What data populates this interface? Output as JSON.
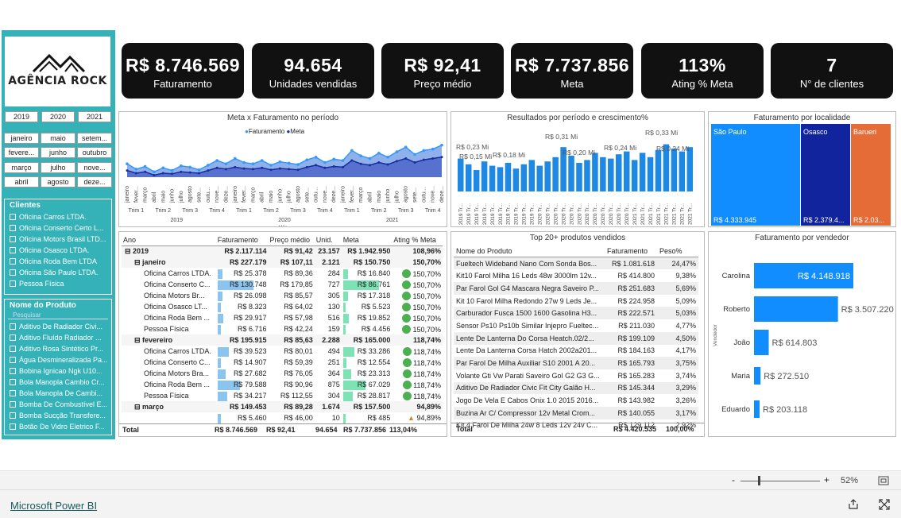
{
  "logo": {
    "text": "AGÊNCIA ROCK"
  },
  "years": [
    "2019",
    "2020",
    "2021"
  ],
  "months": [
    "janeiro",
    "maio",
    "setem...",
    "fevere...",
    "junho",
    "outubro",
    "março",
    "julho",
    "nove...",
    "abril",
    "agosto",
    "deze..."
  ],
  "clients": {
    "title": "Clientes",
    "items": [
      "Oficina Carros LTDA.",
      "Oficina Conserto Certo L...",
      "Oficina Motors Brasil LTD...",
      "Oficina Osasco LTDA.",
      "Oficina Roda Bem LTDA",
      "Oficina São Paulo LTDA.",
      "Pessoa Física"
    ]
  },
  "products_filter": {
    "title": "Nome do Produto",
    "placeholder": "Pesquisar",
    "items": [
      "Aditivo De Radiador Civi...",
      "Aditivo Fluído Radiador ...",
      "Aditivo Rosa Sintético Pr...",
      "Água Desmineralizada Pa...",
      "Bobina Ignicao Ngk U10...",
      "Bola Manopla Cambio Cr...",
      "Bola Manopla De Cambi...",
      "Bomba De Combustível E...",
      "Bomba Sucção Transfere...",
      "Botão De Vidro Eletrico F..."
    ]
  },
  "kpis": [
    {
      "value": "R$ 8.746.569",
      "label": "Faturamento"
    },
    {
      "value": "94.654",
      "label": "Unidades vendidas"
    },
    {
      "value": "R$ 92,41",
      "label": "Preço médio"
    },
    {
      "value": "R$ 7.737.856",
      "label": "Meta"
    },
    {
      "value": "113%",
      "label": "Ating % Meta"
    },
    {
      "value": "7",
      "label": "N° de clientes"
    }
  ],
  "chart_data": [
    {
      "type": "area",
      "title": "Meta x Faturamento no período",
      "series": [
        {
          "name": "Faturamento"
        },
        {
          "name": "Meta"
        }
      ],
      "x_months": [
        "janeiro",
        "fever...",
        "março",
        "abril",
        "maio",
        "junho",
        "julho",
        "agosto",
        "sete...",
        "outu...",
        "nove...",
        "deze..."
      ],
      "quarters": [
        "Trim 1",
        "Trim 2",
        "Trim 3",
        "Trim 4"
      ],
      "years": [
        "2019",
        "2020",
        "2021"
      ],
      "xlabel": "Mês"
    },
    {
      "type": "bar",
      "title": "Resultados por período e crescimento%",
      "annotations": [
        "R$ 0,23 Mi",
        "R$ 0,15 Mi",
        "R$ 0,18 Mi",
        "R$ 0,31 Mi",
        "R$ 0,20 Mi",
        "R$ 0,24 Mi",
        "R$ 0,33 Mi",
        "R$ 0,24 Mi"
      ],
      "x_labels": [
        "2019 Tr...",
        "2019 Tr...",
        "2019 Tr...",
        "2019 Tr...",
        "2019 Tr...",
        "2019 Tr...",
        "2019 Tr...",
        "2019 Tr...",
        "2019 Tr...",
        "2019 Tr...",
        "2020 Tr...",
        "2020 Tr...",
        "2020 Tr...",
        "2020 Tr...",
        "2020 Tr...",
        "2020 Tr...",
        "2020 Tr...",
        "2020 Tr...",
        "2020 Tr...",
        "2020 Tr...",
        "2020 Tr...",
        "2020 Tr...",
        "2021 Tr...",
        "2021 Tr...",
        "2021 Tr...",
        "2021 Tr...",
        "2021 Tr...",
        "2021 Tr...",
        "2021 Tr...",
        "2021 Tr..."
      ],
      "values": [
        0.23,
        0.19,
        0.15,
        0.21,
        0.18,
        0.17,
        0.2,
        0.16,
        0.19,
        0.22,
        0.18,
        0.21,
        0.24,
        0.31,
        0.25,
        0.2,
        0.22,
        0.27,
        0.24,
        0.23,
        0.26,
        0.28,
        0.22,
        0.27,
        0.24,
        0.29,
        0.33,
        0.3,
        0.28,
        0.31
      ]
    },
    {
      "type": "treemap",
      "title": "Faturamento por localidade",
      "categories": [
        "São Paulo",
        "Osasco",
        "Barueri"
      ],
      "labels": [
        "R$ 4.333.945",
        "R$ 2.379.4...",
        "R$ 2.03..."
      ],
      "values": [
        4333945,
        2379400,
        2033224
      ]
    },
    {
      "type": "bar",
      "title": "Faturamento por vendedor",
      "ylabel": "Vendedor",
      "categories": [
        "Carolina",
        "Roberto",
        "João",
        "Maria",
        "Eduardo"
      ],
      "values": [
        4148918,
        3507220,
        614803,
        272510,
        203118
      ],
      "labels": [
        "R$ 4.148.918",
        "R$ 3.507.220",
        "R$ 614.803",
        "R$ 272.510",
        "R$ 203.118"
      ]
    }
  ],
  "matrix": {
    "headers": [
      "Ano",
      "Faturamento",
      "Preço médio",
      "Unid.",
      "Meta",
      "Ating % Meta"
    ],
    "rows": [
      {
        "lvl": 0,
        "c": [
          "⊟ 2019",
          "R$ 2.117.114",
          "R$ 91,42",
          "23.157",
          "R$ 1.942.950",
          "108,96%"
        ],
        "b": 1
      },
      {
        "lvl": 1,
        "c": [
          "⊟ janeiro",
          "R$ 227.179",
          "R$ 107,11",
          "2.121",
          "R$ 150.750",
          "150,70%"
        ],
        "b": 1
      },
      {
        "lvl": 2,
        "c": [
          "Oficina Carros LTDA.",
          "R$ 25.378",
          "R$ 89,36",
          "284",
          "R$ 16.840",
          "150,70%"
        ]
      },
      {
        "lvl": 2,
        "c": [
          "Oficina Conserto C...",
          "R$ 130.748",
          "R$ 179,85",
          "727",
          "R$ 86.761",
          "150,70%"
        ]
      },
      {
        "lvl": 2,
        "c": [
          "Oficina Motors Br...",
          "R$ 26.098",
          "R$ 85,57",
          "305",
          "R$ 17.318",
          "150,70%"
        ]
      },
      {
        "lvl": 2,
        "c": [
          "Oficina Osasco LT...",
          "R$ 8.323",
          "R$ 64,02",
          "130",
          "R$ 5.523",
          "150,70%"
        ]
      },
      {
        "lvl": 2,
        "c": [
          "Oficina Roda Bem ...",
          "R$ 29.917",
          "R$ 57,98",
          "516",
          "R$ 19.852",
          "150,70%"
        ]
      },
      {
        "lvl": 2,
        "c": [
          "Pessoa Física",
          "R$ 6.716",
          "R$ 42,24",
          "159",
          "R$ 4.456",
          "150,70%"
        ]
      },
      {
        "lvl": 1,
        "c": [
          "⊟ fevereiro",
          "R$ 195.915",
          "R$ 85,63",
          "2.288",
          "R$ 165.000",
          "118,74%"
        ],
        "b": 1
      },
      {
        "lvl": 2,
        "c": [
          "Oficina Carros LTDA.",
          "R$ 39.523",
          "R$ 80,01",
          "494",
          "R$ 33.286",
          "118,74%"
        ]
      },
      {
        "lvl": 2,
        "c": [
          "Oficina Conserto C...",
          "R$ 14.907",
          "R$ 59,39",
          "251",
          "R$ 12.554",
          "118,74%"
        ]
      },
      {
        "lvl": 2,
        "c": [
          "Oficina Motors Bra...",
          "R$ 27.682",
          "R$ 76,05",
          "364",
          "R$ 23.313",
          "118,74%"
        ]
      },
      {
        "lvl": 2,
        "c": [
          "Oficina Roda Bem ...",
          "R$ 79.588",
          "R$ 90,96",
          "875",
          "R$ 67.029",
          "118,74%"
        ]
      },
      {
        "lvl": 2,
        "c": [
          "Pessoa Física",
          "R$ 34.217",
          "R$ 112,55",
          "304",
          "R$ 28.817",
          "118,74%"
        ]
      },
      {
        "lvl": 1,
        "c": [
          "⊟ março",
          "R$ 149.453",
          "R$ 89,28",
          "1.674",
          "R$ 157.500",
          "94,89%"
        ],
        "b": 1
      },
      {
        "lvl": 2,
        "c": [
          "",
          "R$ 5.460",
          "R$ 46,00",
          "10",
          "R$ 485",
          "94,89%"
        ]
      }
    ],
    "total": [
      "Total",
      "R$ 8.746.569",
      "R$ 92,41",
      "94.654",
      "R$ 7.737.856",
      "113,04%"
    ]
  },
  "top": {
    "title": "Top 20+ produtos vendidos",
    "headers": [
      "Nome do Produto",
      "Faturamento",
      "Peso%"
    ],
    "rows": [
      [
        "Fueltech Wideband Nano Com Sonda Bos...",
        "R$ 1.081.618",
        "24,47%"
      ],
      [
        "Kit10 Farol Milha 16 Leds 48w 3000lm 12v...",
        "R$ 414.800",
        "9,38%"
      ],
      [
        "Par Farol Gol G4 Mascara Negra Saveiro P...",
        "R$ 251.683",
        "5,69%"
      ],
      [
        "Kit 10 Farol Milha Redondo 27w 9 Leds Je...",
        "R$ 224.958",
        "5,09%"
      ],
      [
        "Carburador Fusca 1500 1600 Gasolina H3...",
        "R$ 222.571",
        "5,03%"
      ],
      [
        "Sensor Ps10 Ps10b Similar Injepro Fueltec...",
        "R$ 211.030",
        "4,77%"
      ],
      [
        "Lente De Lanterna Do Corsa Heatch.02/2...",
        "R$ 199.109",
        "4,50%"
      ],
      [
        "Lente Da Lanterna Corsa Hatch 2002a201...",
        "R$ 184.163",
        "4,17%"
      ],
      [
        "Par Farol De Milha Auxiliar S10 2001 A 20...",
        "R$ 165.793",
        "3,75%"
      ],
      [
        "Volante Gti Vw Parati Saveiro Gol G2 G3 G...",
        "R$ 165.283",
        "3,74%"
      ],
      [
        "Aditivo De Radiador Civic Fit City Galão H...",
        "R$ 145.344",
        "3,29%"
      ],
      [
        "Jogo De Vela E Cabos Onix 1.0 2015 2016...",
        "R$ 143.982",
        "3,26%"
      ],
      [
        "Buzina Ar C/ Compressor 12v Metal Crom...",
        "R$ 140.055",
        "3,17%"
      ],
      [
        "Kit 4 Farol De Milha 24w 8 Leds 12v 24v C...",
        "R$ 129.112",
        "2,92%"
      ]
    ],
    "total": [
      "Total",
      "R$ 4.420.535",
      "100,00%"
    ]
  },
  "status": {
    "zoom": "52%",
    "minus": "-",
    "plus": "+"
  },
  "footer": {
    "brand": "Microsoft Power BI"
  },
  "colors": {
    "teal": "#35b1b8",
    "light_blue": "#3399ff",
    "dark_blue": "#1a2ca0",
    "orange": "#e8703a",
    "bar_blue": "#1e88e5",
    "vendor_blue": "#118dff"
  }
}
